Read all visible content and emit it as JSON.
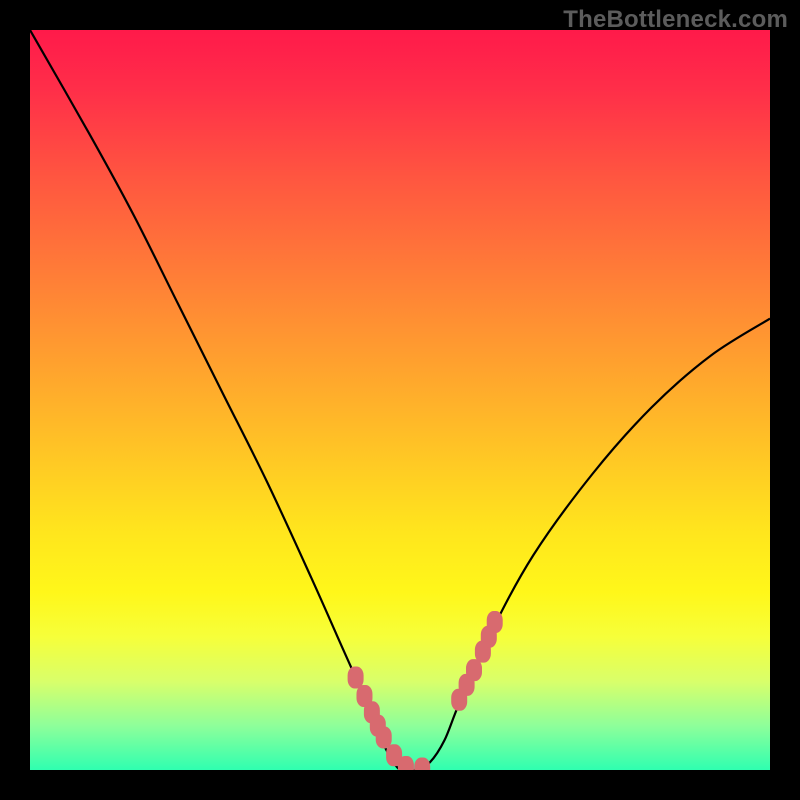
{
  "watermark": "TheBottleneck.com",
  "colors": {
    "frame": "#000000",
    "gradient_top": "#ff1a4a",
    "gradient_mid": "#ffe61d",
    "gradient_bottom": "#2fffb0",
    "curve": "#000000",
    "marker": "#d86a6f",
    "watermark_text": "#5c5c5c"
  },
  "chart_data": {
    "type": "line",
    "title": "",
    "xlabel": "",
    "ylabel": "",
    "xlim": [
      0,
      100
    ],
    "ylim": [
      0,
      100
    ],
    "grid": false,
    "legend": false,
    "series": [
      {
        "name": "bottleneck-curve",
        "x": [
          0,
          8,
          14,
          20,
          26,
          32,
          38,
          42,
          46,
          48,
          50,
          52,
          54,
          56,
          58,
          62,
          68,
          76,
          84,
          92,
          100
        ],
        "y": [
          100,
          86,
          75,
          63,
          51,
          39,
          26,
          17,
          8,
          3,
          0,
          0,
          1,
          4,
          9,
          18,
          29,
          40,
          49,
          56,
          61
        ]
      }
    ],
    "markers": {
      "name": "highlighted-points",
      "x": [
        44.0,
        45.2,
        46.2,
        47.0,
        47.8,
        49.2,
        50.8,
        53.0,
        58.0,
        59.0,
        60.0,
        61.2,
        62.0,
        62.8
      ],
      "y": [
        12.5,
        10.0,
        7.8,
        6.0,
        4.4,
        2.0,
        0.4,
        0.2,
        9.5,
        11.5,
        13.5,
        16.0,
        18.0,
        20.0
      ]
    }
  }
}
